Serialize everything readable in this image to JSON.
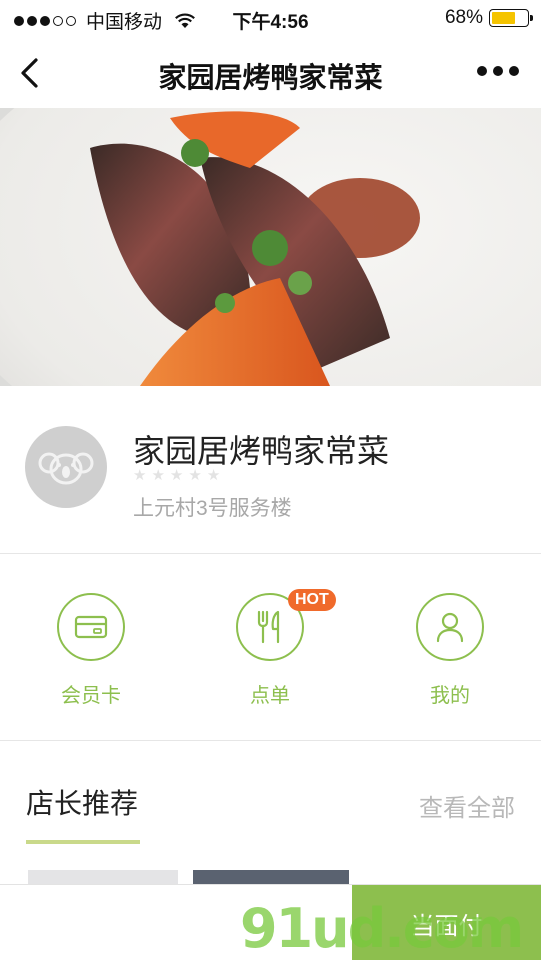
{
  "status_bar": {
    "carrier": "中国移动",
    "time": "下午4:56",
    "battery": "68%",
    "battery_level": 0.68,
    "signal_dots_filled": 3,
    "signal_dots_total": 5
  },
  "nav": {
    "title": "家园居烤鸭家常菜",
    "back_icon": "chevron-left-icon",
    "more_icon": "more-dots-icon"
  },
  "shop": {
    "name": "家园居烤鸭家常菜",
    "address": "上元村3号服务楼",
    "rating": 0,
    "rating_max": 5,
    "avatar_icon": "koala-icon"
  },
  "features": [
    {
      "label": "会员卡",
      "icon": "card-icon"
    },
    {
      "label": "点单",
      "icon": "fork-knife-icon",
      "badge": "HOT"
    },
    {
      "label": "我的",
      "icon": "user-icon"
    }
  ],
  "recommend": {
    "title": "店长推荐",
    "view_all": "查看全部"
  },
  "bottom": {
    "pay_label": "当面付",
    "watermark": "91ud.com"
  },
  "colors": {
    "accent": "#8dbf4e",
    "hot_badge": "#f06a2b",
    "battery": "#f5c400"
  }
}
